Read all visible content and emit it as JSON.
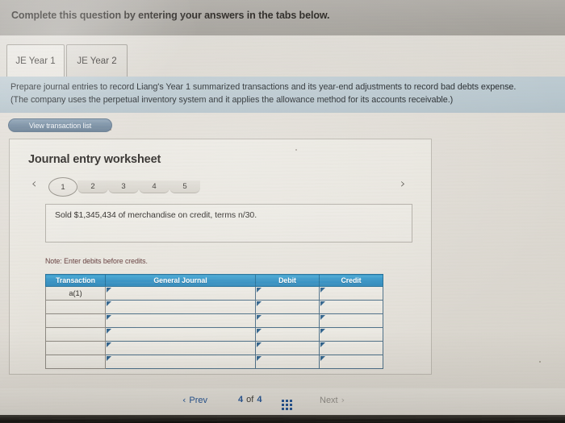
{
  "header": {
    "title": "Complete this question by entering your answers in the tabs below."
  },
  "tabs": [
    {
      "label": "JE Year 1",
      "active": true
    },
    {
      "label": "JE Year 2",
      "active": false
    }
  ],
  "instructions": {
    "line1": "Prepare journal entries to record Liang's Year 1 summarized transactions and its year-end adjustments to record bad debts expense.",
    "line2": "(The company uses the perpetual inventory system and it applies the allowance method for its accounts receivable.)"
  },
  "view_transaction_button": {
    "label": "View transaction list"
  },
  "worksheet": {
    "title": "Journal entry worksheet",
    "prev_arrow": "‹",
    "next_arrow": "›",
    "pages": [
      {
        "label": "1",
        "active": true
      },
      {
        "label": "2",
        "active": false
      },
      {
        "label": "3",
        "active": false
      },
      {
        "label": "4",
        "active": false
      },
      {
        "label": "5",
        "active": false
      }
    ],
    "transaction_description": "Sold $1,345,434 of merchandise on credit, terms n/30.",
    "note": "Note: Enter debits before credits.",
    "table": {
      "columns": [
        "Transaction",
        "General Journal",
        "Debit",
        "Credit"
      ],
      "rows": [
        {
          "transaction": "a(1)",
          "general_journal": "",
          "debit": "",
          "credit": ""
        },
        {
          "transaction": "",
          "general_journal": "",
          "debit": "",
          "credit": ""
        },
        {
          "transaction": "",
          "general_journal": "",
          "debit": "",
          "credit": ""
        },
        {
          "transaction": "",
          "general_journal": "",
          "debit": "",
          "credit": ""
        },
        {
          "transaction": "",
          "general_journal": "",
          "debit": "",
          "credit": ""
        },
        {
          "transaction": "",
          "general_journal": "",
          "debit": "",
          "credit": ""
        }
      ]
    }
  },
  "bottom_nav": {
    "prev_label": "Prev",
    "prev_chevron": "‹",
    "current_page": "4",
    "of_label": "of",
    "total_pages": "4",
    "grid_icon": "grid-icon",
    "next_label": "Next",
    "next_chevron": "›"
  },
  "colors": {
    "header_band": "#aba8a3",
    "instruction_band": "#b7c6ce",
    "table_header_blue": "#2f90c4",
    "accent_blue": "#1f4f8f",
    "note_text": "#5a3030",
    "page_background": "#ded9d2"
  }
}
